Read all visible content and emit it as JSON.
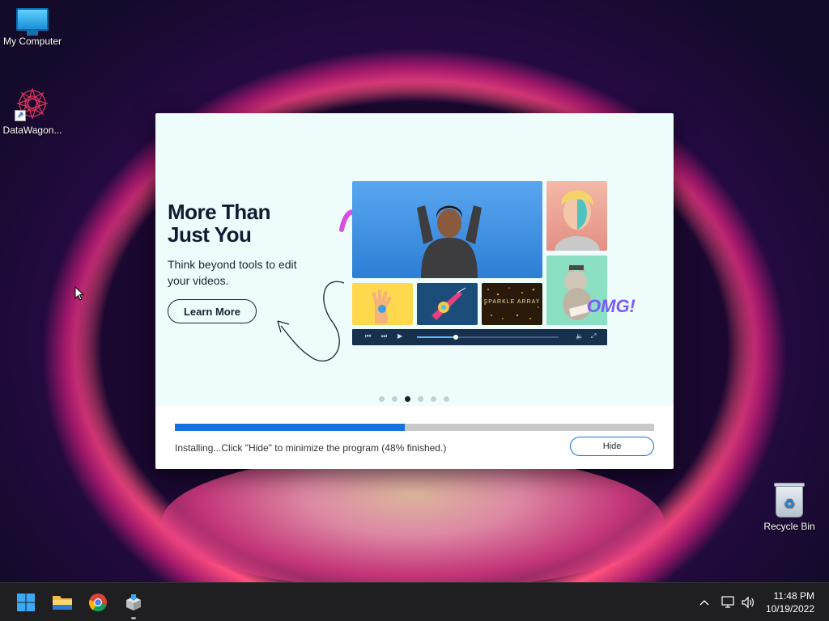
{
  "desktop": {
    "icons": [
      {
        "label": "My Computer"
      },
      {
        "label": "DataWagon..."
      },
      {
        "label": "Recycle Bin"
      }
    ]
  },
  "installer": {
    "hero": {
      "title_line1": "More Than",
      "title_line2": "Just You",
      "subtitle": "Think beyond tools to edit your videos.",
      "learn_more_label": "Learn More"
    },
    "collage": {
      "sparkle_text": "SPARKLE ARRAY",
      "sticker_text": "OMG!"
    },
    "carousel": {
      "total": 6,
      "active_index": 2
    },
    "progress": {
      "percent": 48,
      "status_text": "Installing...Click \"Hide\" to minimize the program (48% finished.)",
      "hide_label": "Hide"
    },
    "colors": {
      "accent": "#1673dd",
      "panel_bg": "#eefcfb",
      "title": "#0f1c33"
    }
  },
  "taskbar": {
    "items": [
      "windows-start",
      "file-explorer",
      "chrome",
      "installer-app"
    ],
    "tray_icons": [
      "chevron-up-icon",
      "network-icon",
      "volume-icon"
    ],
    "clock": {
      "time": "11:48 PM",
      "date": "10/19/2022"
    }
  }
}
